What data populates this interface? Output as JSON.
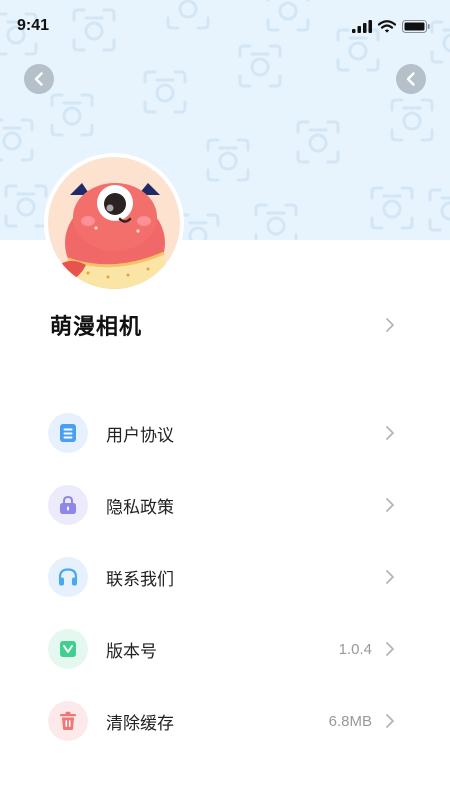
{
  "status_bar": {
    "time": "9:41"
  },
  "app": {
    "name": "萌漫相机"
  },
  "menu": [
    {
      "label": "用户协议",
      "value": "",
      "icon": "document-icon",
      "icon_bg": "#e6f1fd",
      "icon_color": "#4a9ff0"
    },
    {
      "label": "隐私政策",
      "value": "",
      "icon": "lock-icon",
      "icon_bg": "#ecebfb",
      "icon_color": "#8e86e8"
    },
    {
      "label": "联系我们",
      "value": "",
      "icon": "headphones-icon",
      "icon_bg": "#e6f1fd",
      "icon_color": "#4aa8ef"
    },
    {
      "label": "版本号",
      "value": "1.0.4",
      "icon": "version-icon",
      "icon_bg": "#e4f8ef",
      "icon_color": "#3fcf8e"
    },
    {
      "label": "清除缓存",
      "value": "6.8MB",
      "icon": "trash-icon",
      "icon_bg": "#fde9e9",
      "icon_color": "#f07575"
    }
  ],
  "colors": {
    "header_bg": "#e7f3fd",
    "chevron": "#b5b5b5"
  }
}
